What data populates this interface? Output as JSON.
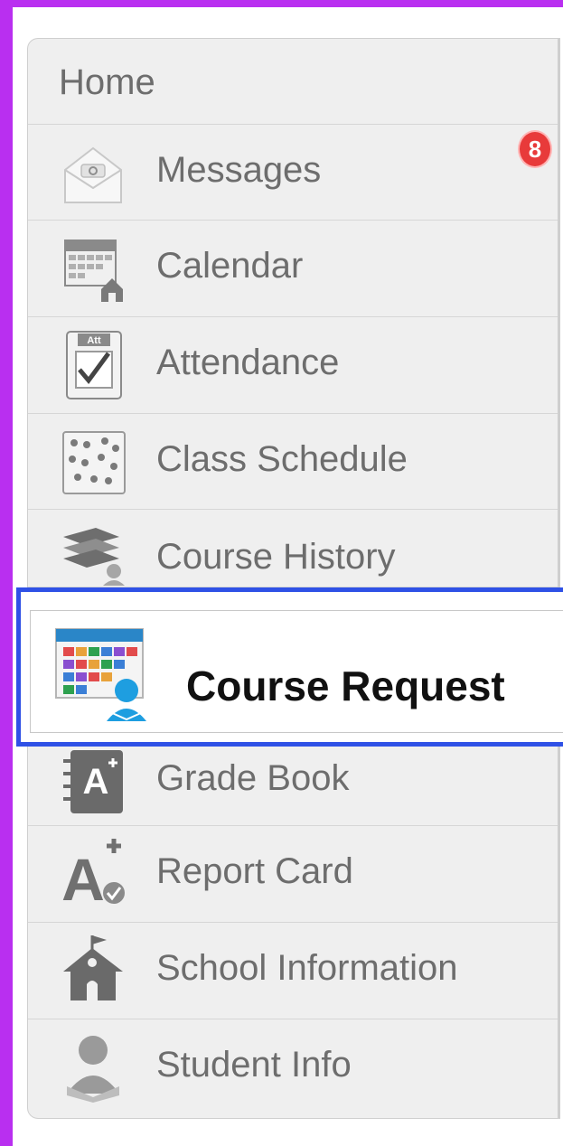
{
  "nav": {
    "items": [
      {
        "label": "Home"
      },
      {
        "label": "Messages",
        "badge": "8"
      },
      {
        "label": "Calendar"
      },
      {
        "label": "Attendance",
        "icon_text": "Att"
      },
      {
        "label": "Class Schedule"
      },
      {
        "label": "Course History"
      },
      {
        "label": "Course Request",
        "active": true
      },
      {
        "label": "Grade Book",
        "icon_text": "A"
      },
      {
        "label": "Report Card",
        "icon_text": "A"
      },
      {
        "label": "School Information"
      },
      {
        "label": "Student Info"
      }
    ]
  },
  "colors": {
    "frame_purple": "#b92ff0",
    "selection_blue": "#2f51e6",
    "badge_red": "#e83a3a",
    "item_bg": "#efefef",
    "text_grey": "#6d6d6d"
  }
}
